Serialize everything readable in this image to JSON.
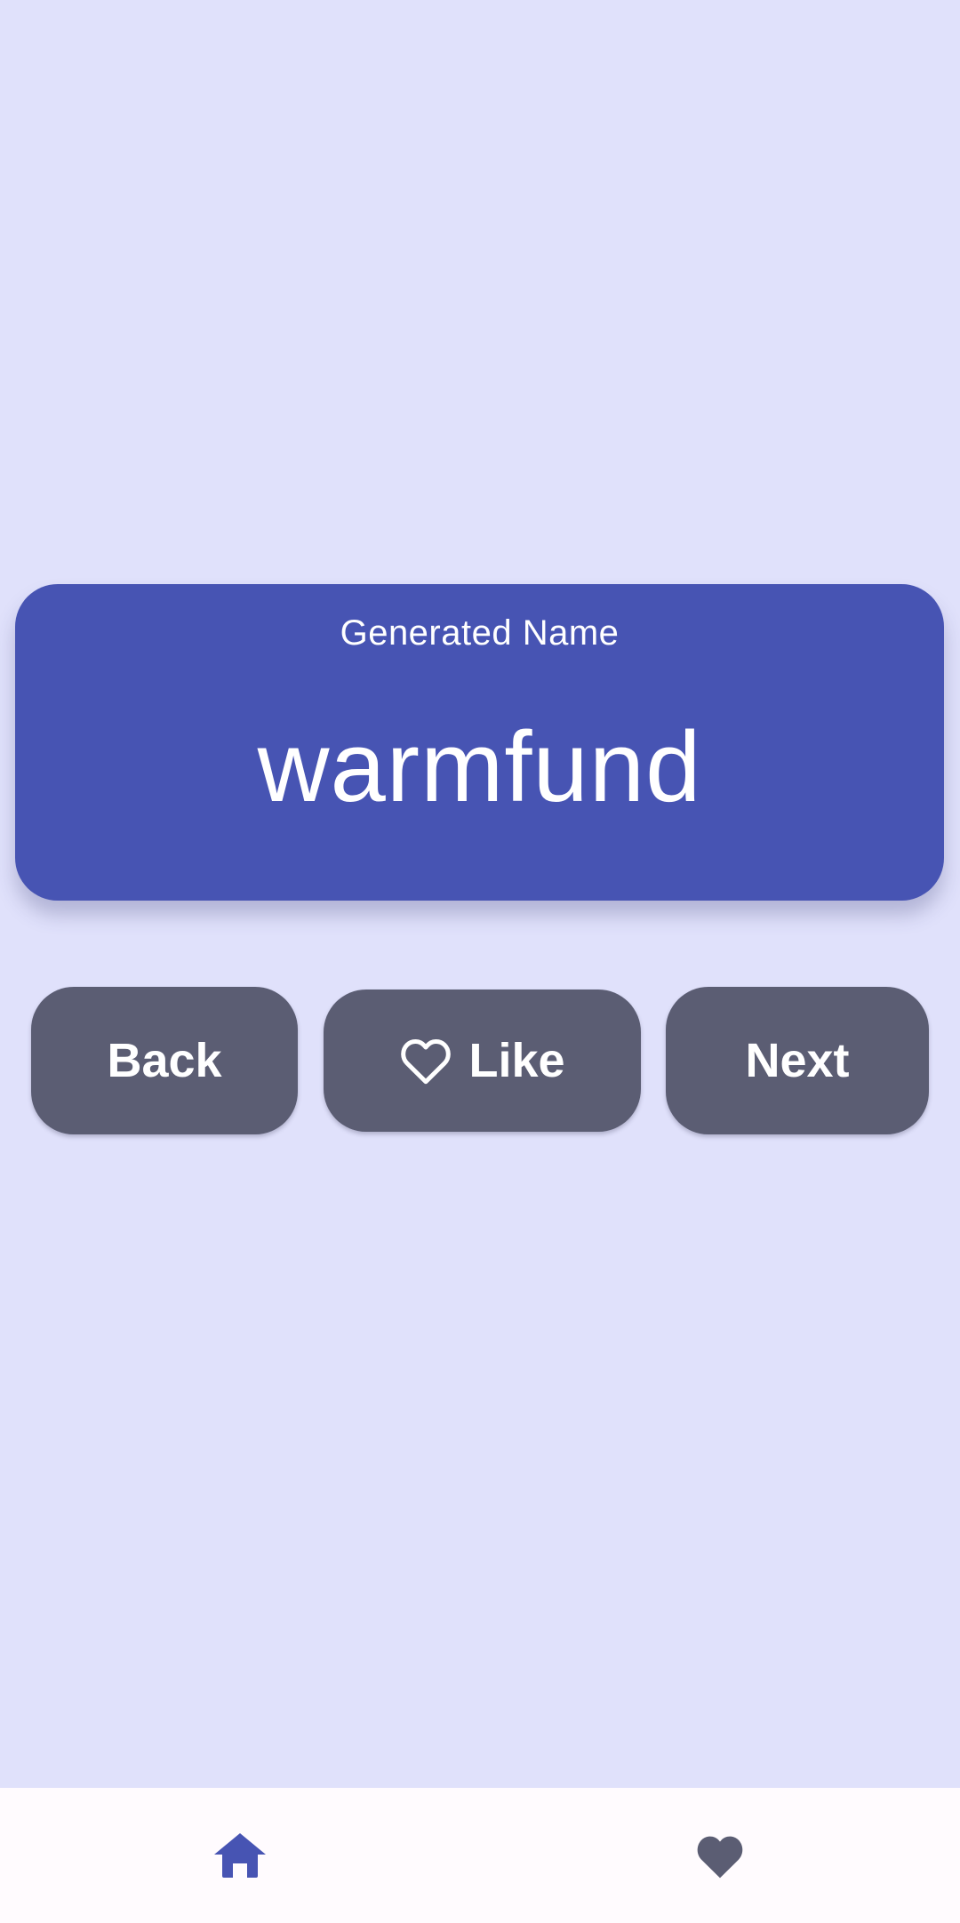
{
  "card": {
    "label": "Generated Name",
    "name": "warmfund"
  },
  "actions": {
    "back_label": "Back",
    "like_label": "Like",
    "next_label": "Next"
  },
  "bottom_nav": {
    "items": [
      {
        "icon": "home-icon",
        "selected": true
      },
      {
        "icon": "heart-icon",
        "selected": false
      }
    ]
  },
  "colors": {
    "background": "#e0e1fb",
    "card": "#4754b3",
    "button": "#5b5d73",
    "nav_selected": "#4754b3",
    "nav_unselected": "#5b5d73"
  }
}
